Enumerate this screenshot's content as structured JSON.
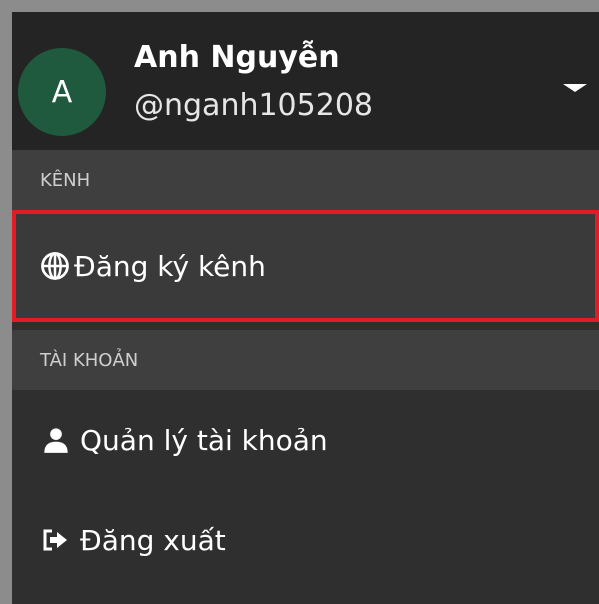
{
  "user": {
    "avatar_letter": "A",
    "name": "Anh Nguyễn",
    "handle": "@nganh105208"
  },
  "sections": {
    "channel": {
      "title": "KÊNH",
      "items": [
        {
          "label": "Đăng ký kênh",
          "icon": "globe-icon"
        }
      ]
    },
    "account": {
      "title": "TÀI KHOẢN",
      "items": [
        {
          "label": "Quản lý tài khoản",
          "icon": "user-icon"
        },
        {
          "label": "Đăng xuất",
          "icon": "logout-icon"
        }
      ]
    }
  },
  "colors": {
    "panel": "#2f2f2f",
    "header": "#242424",
    "section_header": "#3f3f3f",
    "avatar": "#1f5a3f",
    "highlight_border": "#e31b24"
  }
}
